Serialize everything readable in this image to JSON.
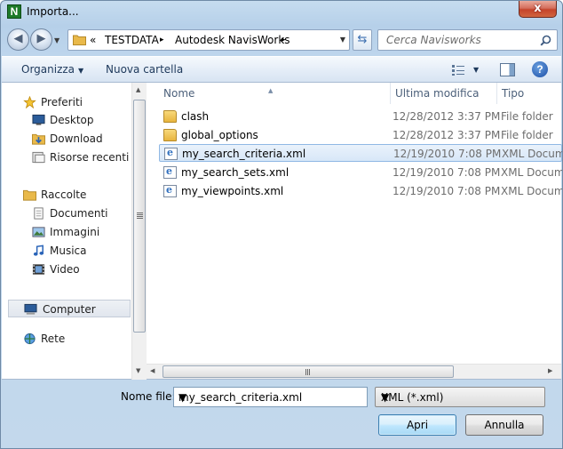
{
  "window": {
    "title": "Importa..."
  },
  "titlebar": {
    "close_glyph": "x"
  },
  "address": {
    "prefix": "«",
    "crumbs": [
      "TESTDATA",
      "Autodesk NavisWorks"
    ],
    "separator": "▸"
  },
  "search": {
    "placeholder": "Cerca Navisworks"
  },
  "toolbar": {
    "organize_label": "Organizza",
    "new_folder_label": "Nuova cartella",
    "help_glyph": "?"
  },
  "nav": {
    "items": [
      {
        "label": "Preferiti",
        "icon": "star-icon"
      },
      {
        "label": "Desktop",
        "icon": "desktop-icon"
      },
      {
        "label": "Download",
        "icon": "download-folder-icon"
      },
      {
        "label": "Risorse recenti",
        "icon": "recent-places-icon"
      },
      {
        "label": "Raccolte",
        "icon": "libraries-icon"
      },
      {
        "label": "Documenti",
        "icon": "documents-icon"
      },
      {
        "label": "Immagini",
        "icon": "pictures-icon"
      },
      {
        "label": "Musica",
        "icon": "music-icon"
      },
      {
        "label": "Video",
        "icon": "video-icon"
      },
      {
        "label": "Computer",
        "icon": "computer-icon"
      },
      {
        "label": "Rete",
        "icon": "network-icon"
      }
    ]
  },
  "columns": {
    "name": "Nome",
    "modified": "Ultima modifica",
    "type": "Tipo"
  },
  "files": [
    {
      "name": "clash",
      "modified": "12/28/2012 3:37 PM",
      "type": "File folder",
      "kind": "folder"
    },
    {
      "name": "global_options",
      "modified": "12/28/2012 3:37 PM",
      "type": "File folder",
      "kind": "folder"
    },
    {
      "name": "my_search_criteria.xml",
      "modified": "12/19/2010 7:08 PM",
      "type": "XML Docum",
      "kind": "xml",
      "selected": true
    },
    {
      "name": "my_search_sets.xml",
      "modified": "12/19/2010 7:08 PM",
      "type": "XML Docum",
      "kind": "xml"
    },
    {
      "name": "my_viewpoints.xml",
      "modified": "12/19/2010 7:08 PM",
      "type": "XML Docum",
      "kind": "xml"
    }
  ],
  "bottom": {
    "filename_label": "Nome file:",
    "filename_value": "my_search_criteria.xml",
    "filetype_value": "XML (*.xml)",
    "open_label": "Apri",
    "cancel_label": "Annulla"
  }
}
